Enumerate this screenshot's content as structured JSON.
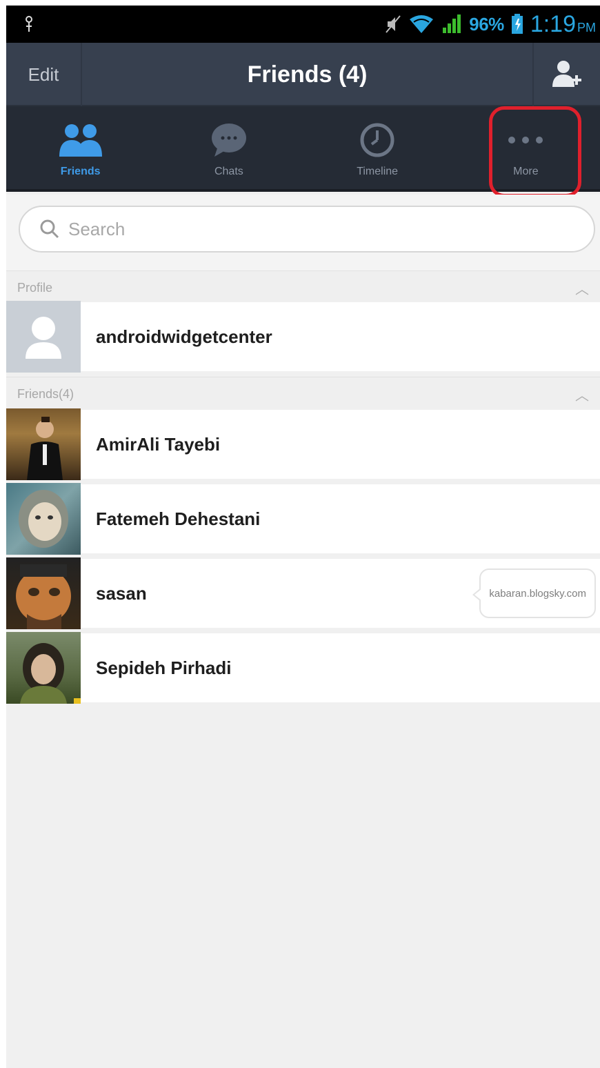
{
  "status_bar": {
    "battery_percent": "96%",
    "time": "1:19",
    "ampm": "PM",
    "icons": [
      "usb-icon",
      "mute-icon",
      "wifi-icon",
      "signal-icon",
      "battery-icon"
    ]
  },
  "header": {
    "edit_label": "Edit",
    "title": "Friends (4)",
    "add_friend_icon": "add-friend-icon"
  },
  "tabs": [
    {
      "label": "Friends",
      "icon": "friends-icon",
      "active": true
    },
    {
      "label": "Chats",
      "icon": "chat-bubble-icon",
      "active": false
    },
    {
      "label": "Timeline",
      "icon": "clock-icon",
      "active": false
    },
    {
      "label": "More",
      "icon": "more-dots-icon",
      "active": false,
      "highlighted": true
    }
  ],
  "search": {
    "placeholder": "Search"
  },
  "profile_section": {
    "header": "Profile",
    "name": "androidwidgetcenter"
  },
  "friends_section": {
    "header": "Friends(4)",
    "items": [
      {
        "name": "AmirAli Tayebi",
        "status": ""
      },
      {
        "name": "Fatemeh Dehestani",
        "status": ""
      },
      {
        "name": "sasan",
        "status": "kabaran.blogsky.com"
      },
      {
        "name": "Sepideh Pirhadi",
        "status": ""
      }
    ]
  },
  "colors": {
    "header_bg": "#37404f",
    "tab_bg": "#252b35",
    "accent": "#3f9be8",
    "highlight": "#e0202c"
  }
}
